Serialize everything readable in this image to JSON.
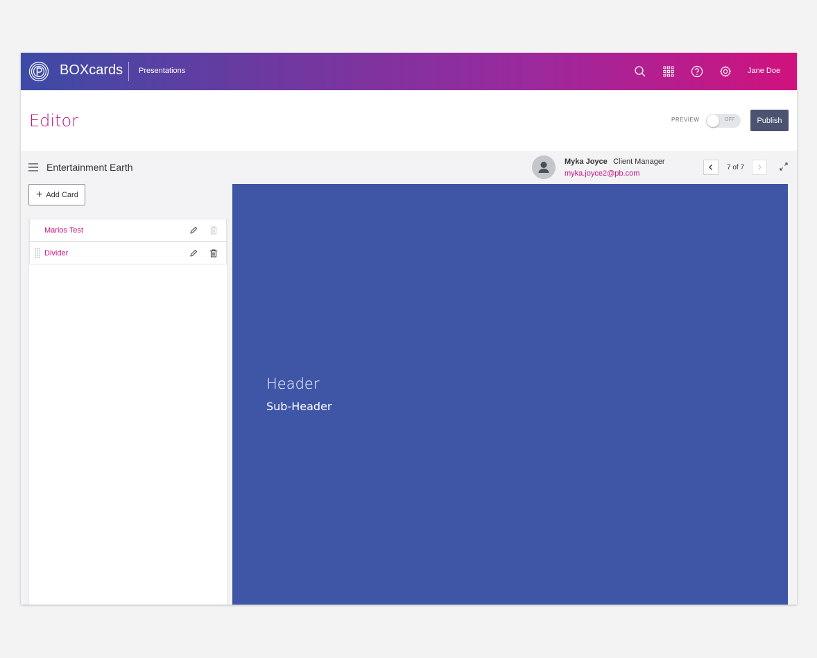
{
  "app": {
    "brand": "BOXcards",
    "section": "Presentations",
    "user": "Jane Doe",
    "icons": [
      "search-icon",
      "apps-grid-icon",
      "help-icon",
      "settings-icon"
    ]
  },
  "editor": {
    "title": "Editor",
    "preview_label": "PREVIEW",
    "preview_toggle": "OFF",
    "publish_label": "Publish"
  },
  "presentation": {
    "name": "Entertainment Earth"
  },
  "contact": {
    "name": "Myka Joyce",
    "role": "Client Manager",
    "email": "myka.joyce2@pb.com"
  },
  "pager": {
    "label": "7 of 7"
  },
  "sidebar": {
    "add_card_label": "Add Card",
    "cards": [
      {
        "label": "Marios Test"
      },
      {
        "label": "Divider"
      }
    ]
  },
  "slide": {
    "header": "Header",
    "subheader": "Sub-Header"
  },
  "colors": {
    "accent": "#c8127f",
    "slide_background": "#3f55a6",
    "publish_button": "#4c5370",
    "gradient_start": "#3c4ba6",
    "gradient_end": "#d0127e"
  }
}
